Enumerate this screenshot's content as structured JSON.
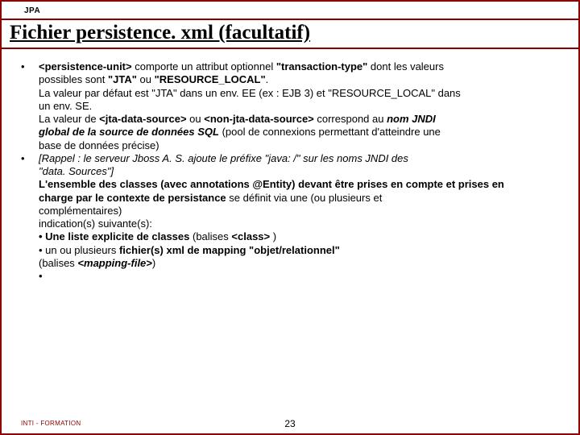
{
  "header": {
    "label": "JPA"
  },
  "title": "Fichier persistence. xml (facultatif)",
  "bullets": [
    {
      "lines": [
        [
          {
            "t": "<persistence-unit>",
            "cls": "b"
          },
          {
            "t": " comporte un attribut optionnel "
          },
          {
            "t": "\"transaction-type\"",
            "cls": "b"
          },
          {
            "t": " dont les valeurs"
          }
        ],
        [
          {
            "t": "possibles sont "
          },
          {
            "t": "\"JTA\"",
            "cls": "b"
          },
          {
            "t": " ou "
          },
          {
            "t": "\"RESOURCE_LOCAL\"",
            "cls": "b"
          },
          {
            "t": "."
          }
        ],
        [
          {
            "t": "La valeur par défaut est \"JTA\" dans un env. EE (ex : EJB 3) et \"RESOURCE_LOCAL\" dans"
          }
        ],
        [
          {
            "t": "un env. SE."
          }
        ],
        [
          {
            "t": "La valeur de "
          },
          {
            "t": "<jta-data-source>",
            "cls": "b"
          },
          {
            "t": " ou "
          },
          {
            "t": "<non-jta-data-source>",
            "cls": "b"
          },
          {
            "t": " correspond au "
          },
          {
            "t": "nom JNDI",
            "cls": "bi"
          }
        ],
        [
          {
            "t": "global de la source de données SQL",
            "cls": "bi"
          },
          {
            "t": " (pool de connexions permettant d'atteindre une"
          }
        ],
        [
          {
            "t": "base de données précise)"
          }
        ]
      ]
    },
    {
      "lines": [
        [
          {
            "t": "[Rappel : le serveur Jboss A. S. ajoute le préfixe \"java: /\" sur les noms JNDI des",
            "cls": "i"
          }
        ],
        [
          {
            "t": "\"data. Sources\"]",
            "cls": "i"
          }
        ],
        [
          {
            "t": "L'ensemble des classes (avec annotations @Entity) devant être prises en compte et prises en",
            "cls": "b"
          }
        ],
        [
          {
            "t": "charge par le contexte de persistance",
            "cls": "b"
          },
          {
            "t": " se définit via une (ou plusieurs et"
          }
        ],
        [
          {
            "t": "complémentaires)"
          }
        ],
        [
          {
            "t": "indication(s) suivante(s):"
          }
        ],
        [
          {
            "t": "• Une liste explicite de classes",
            "cls": "b"
          },
          {
            "t": " (balises "
          },
          {
            "t": "<class>",
            "cls": "b"
          },
          {
            "t": " )"
          }
        ],
        [
          {
            "t": "• un ou plusieurs "
          },
          {
            "t": "fichier(s) xml de mapping \"objet/relationnel\"",
            "cls": "b"
          }
        ],
        [
          {
            "t": "(balises "
          },
          {
            "t": "<mapping-file>",
            "cls": "bi"
          },
          {
            "t": ")"
          }
        ],
        [
          {
            "t": "•"
          }
        ]
      ]
    }
  ],
  "footer": {
    "left": "INTI - FORMATION",
    "page": "23"
  }
}
